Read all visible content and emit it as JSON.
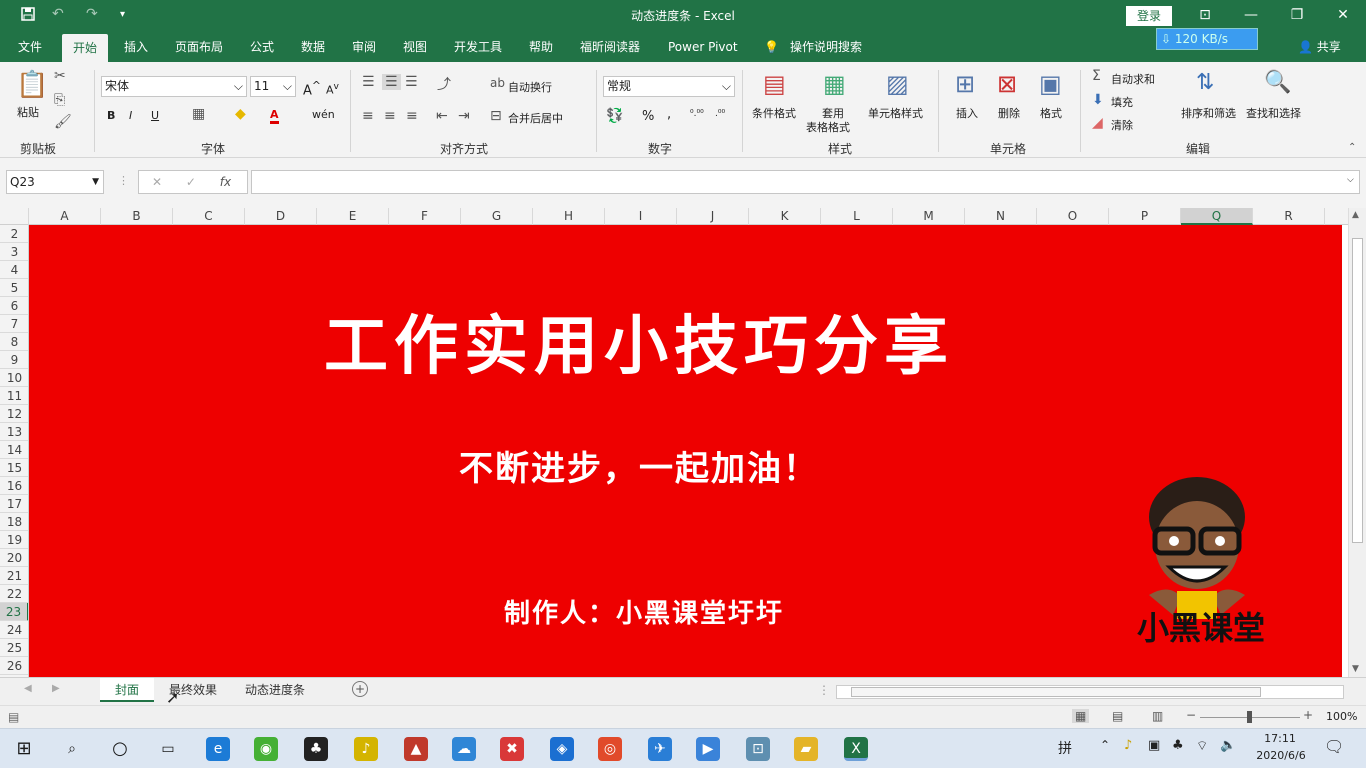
{
  "window": {
    "title": "动态进度条  -  Excel",
    "login": "登录",
    "share": "共享"
  },
  "menu": {
    "tabs": [
      "文件",
      "开始",
      "插入",
      "页面布局",
      "公式",
      "数据",
      "审阅",
      "视图",
      "开发工具",
      "帮助",
      "福昕阅读器",
      "Power Pivot"
    ],
    "tell_me": "操作说明搜索",
    "speed": "120 KB/s"
  },
  "ribbon": {
    "clipboard": {
      "paste": "粘贴",
      "label": "剪贴板"
    },
    "font": {
      "name": "宋体",
      "size": "11",
      "bold": "B",
      "italic": "I",
      "underline": "U",
      "label": "字体"
    },
    "alignment": {
      "wrap": "自动换行",
      "merge": "合并后居中",
      "label": "对齐方式"
    },
    "number": {
      "format": "常规",
      "percent": "%",
      "comma": ",",
      "label": "数字"
    },
    "styles": {
      "conditional": "条件格式",
      "table_fmt_1": "套用",
      "table_fmt_2": "表格格式",
      "cell_styles": "单元格样式",
      "label": "样式"
    },
    "cells": {
      "insert": "插入",
      "delete": "删除",
      "format": "格式",
      "label": "单元格"
    },
    "editing": {
      "autosum": "自动求和",
      "fill": "填充",
      "clear": "清除",
      "sort": "排序和筛选",
      "find": "查找和选择",
      "label": "编辑"
    }
  },
  "formula_bar": {
    "name_box": "Q23",
    "fx": "fx",
    "value": ""
  },
  "columns": [
    "A",
    "B",
    "C",
    "D",
    "E",
    "F",
    "G",
    "H",
    "I",
    "J",
    "K",
    "L",
    "M",
    "N",
    "O",
    "P",
    "Q",
    "R"
  ],
  "rows": [
    "2",
    "3",
    "4",
    "5",
    "6",
    "7",
    "8",
    "9",
    "10",
    "11",
    "12",
    "13",
    "14",
    "15",
    "16",
    "17",
    "18",
    "19",
    "20",
    "21",
    "22",
    "23",
    "24",
    "25",
    "26"
  ],
  "cover": {
    "title": "工作实用小技巧分享",
    "slogan": "不断进步，一起加油！",
    "author": "制作人：小黑课堂圩圩",
    "logo_text": "小黑课堂",
    "bg_color": "#ee0000"
  },
  "sheets": {
    "tabs": [
      "封面",
      "最终效果",
      "动态进度条"
    ],
    "active": "封面"
  },
  "status": {
    "zoom": "100%"
  },
  "taskbar": {
    "ime": "拼",
    "time": "17:11",
    "date": "2020/6/6"
  }
}
